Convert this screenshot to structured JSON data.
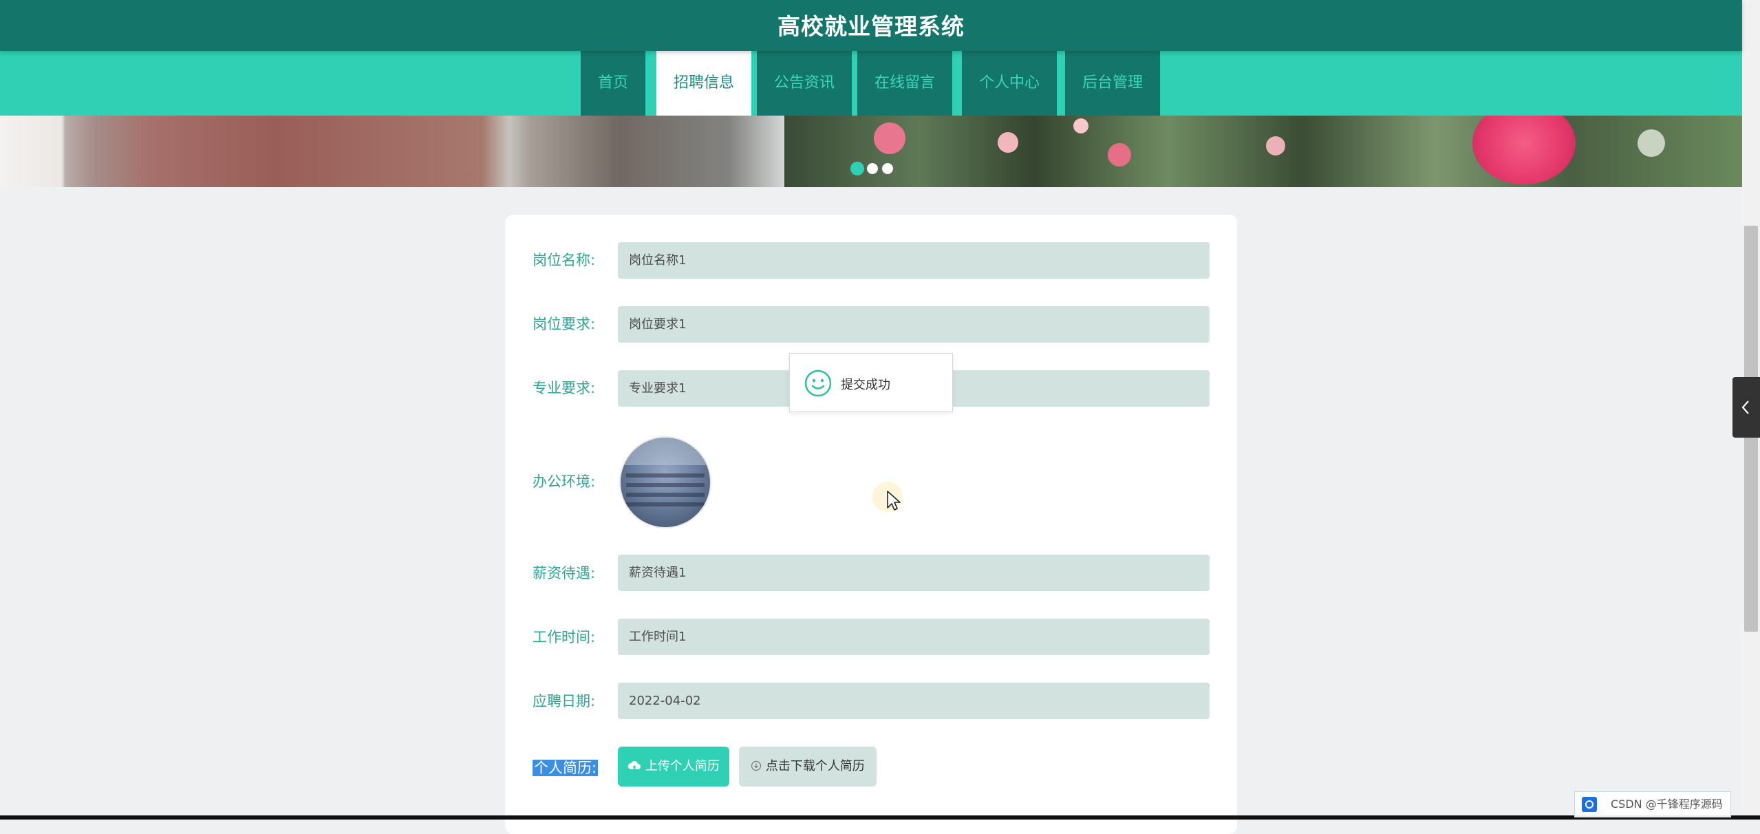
{
  "header": {
    "title": "高校就业管理系统"
  },
  "nav": {
    "items": [
      {
        "label": "首页"
      },
      {
        "label": "招聘信息",
        "active": true
      },
      {
        "label": "公告资讯"
      },
      {
        "label": "在线留言"
      },
      {
        "label": "个人中心"
      },
      {
        "label": "后台管理"
      }
    ]
  },
  "carousel": {
    "slides": 3,
    "active_index": 0
  },
  "form": {
    "job_name": {
      "label": "岗位名称:",
      "value": "岗位名称1"
    },
    "job_requirement": {
      "label": "岗位要求:",
      "value": "岗位要求1"
    },
    "major_requirement": {
      "label": "专业要求:",
      "value": "专业要求1"
    },
    "office_environment": {
      "label": "办公环境:"
    },
    "salary": {
      "label": "薪资待遇:",
      "value": "薪资待遇1"
    },
    "work_time": {
      "label": "工作时间:",
      "value": "工作时间1"
    },
    "apply_date": {
      "label": "应聘日期:",
      "value": "2022-04-02"
    },
    "resume": {
      "label": "个人简历:",
      "upload_button": "上传个人简历",
      "download_button": "点击下载个人简历"
    }
  },
  "toast": {
    "message": "提交成功",
    "icon": "smile-icon"
  },
  "watermark": {
    "text": "CSDN @千锋程序源码"
  },
  "colors": {
    "header_bg": "#14766a",
    "nav_bg": "#2fd0b4",
    "input_bg": "#d2e2df",
    "label": "#2fa593"
  }
}
